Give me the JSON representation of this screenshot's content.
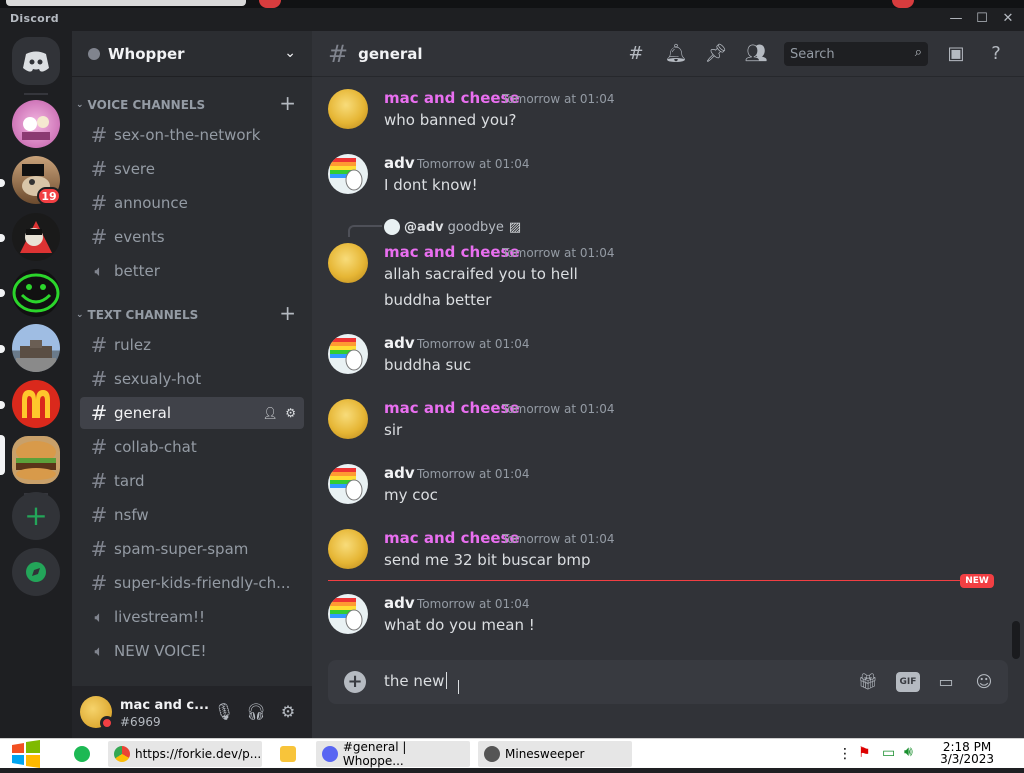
{
  "window": {
    "app_name": "Discord"
  },
  "servers": {
    "badge_count": "19"
  },
  "guild": {
    "name": "Whopper"
  },
  "sidebar": {
    "voice_category": "VOICE CHANNELS",
    "text_category": "TEXT CHANNELS",
    "voice_channels": [
      "sex-on-the-network",
      "svere",
      "announce",
      "events",
      "better"
    ],
    "text_channels": [
      "rulez",
      "sexualy-hot",
      "general",
      "collab-chat",
      "tard",
      "nsfw",
      "spam-super-spam",
      "super-kids-friendly-ch...",
      "livestream!!",
      "NEW VOICE!"
    ],
    "active_channel": "general"
  },
  "user": {
    "name": "mac and c...",
    "tag": "#6969"
  },
  "channel": {
    "name": "general",
    "search_placeholder": "Search"
  },
  "messages": [
    {
      "author": "mac and cheese",
      "timestamp": "Tomorrow at 01:04",
      "lines": [
        "who banned you?"
      ]
    },
    {
      "author": "adv",
      "timestamp": "Tomorrow at 01:04",
      "lines": [
        "I dont know!"
      ]
    },
    {
      "reply_to": "@adv",
      "reply_text": "goodbye",
      "author": "mac and cheese",
      "timestamp": "Tomorrow at 01:04",
      "lines": [
        "allah sacraifed you to hell",
        "buddha better"
      ]
    },
    {
      "author": "adv",
      "timestamp": "Tomorrow at 01:04",
      "lines": [
        "buddha suc"
      ]
    },
    {
      "author": "mac and cheese",
      "timestamp": "Tomorrow at 01:04",
      "lines": [
        "sir"
      ]
    },
    {
      "author": "adv",
      "timestamp": "Tomorrow at 01:04",
      "lines": [
        "my coc"
      ]
    },
    {
      "author": "mac and cheese",
      "timestamp": "Tomorrow at 01:04",
      "lines": [
        "send me 32 bit buscar bmp"
      ]
    },
    {
      "author": "adv",
      "timestamp": "Tomorrow at 01:04",
      "lines": [
        "what do you mean !"
      ]
    }
  ],
  "new_divider": "NEW",
  "composer": {
    "draft": "the new",
    "gif_label": "GIF"
  },
  "taskbar": {
    "items": [
      "https://forkie.dev/p...",
      "#general | Whoppe...",
      "Minesweeper"
    ],
    "time": "2:18 PM",
    "date": "3/3/2023"
  },
  "colors": {
    "accent_mention": "#e96ff0",
    "unread_red": "#f23f43",
    "online_green": "#23a559"
  }
}
